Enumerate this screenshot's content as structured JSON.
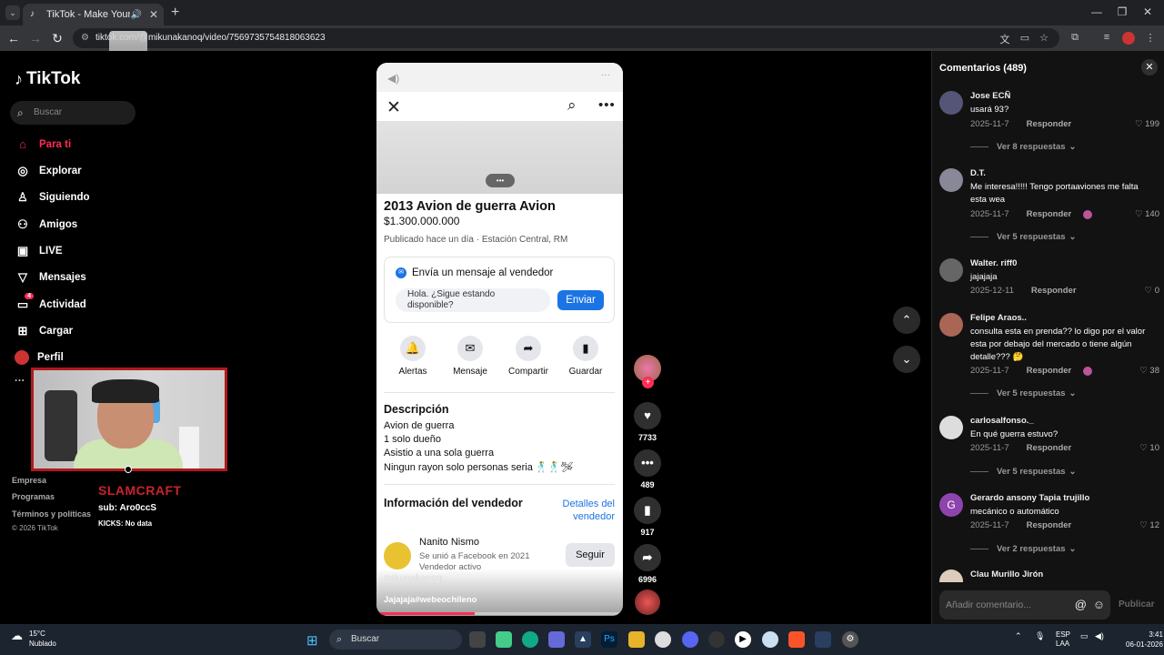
{
  "browser": {
    "tab_title": "TikTok - Make Your Day",
    "url": "tiktok.com/@mikunakanoq/video/7569735754818063623"
  },
  "sidebar": {
    "logo": "TikTok",
    "search_placeholder": "Buscar",
    "items": [
      {
        "label": "Para ti",
        "icon": "home-icon"
      },
      {
        "label": "Explorar",
        "icon": "compass-icon"
      },
      {
        "label": "Siguiendo",
        "icon": "following-icon"
      },
      {
        "label": "Amigos",
        "icon": "friends-icon"
      },
      {
        "label": "LIVE",
        "icon": "live-icon"
      },
      {
        "label": "Mensajes",
        "icon": "messages-icon"
      },
      {
        "label": "Actividad",
        "icon": "activity-icon",
        "badge": "4"
      },
      {
        "label": "Cargar",
        "icon": "upload-icon"
      },
      {
        "label": "Perfil",
        "icon": "profile-icon"
      }
    ],
    "more": "···",
    "footer_company": "Empresa",
    "footer_programs": "Programas",
    "footer_terms": "Términos y políticas",
    "copyright": "© 2026 TikTok"
  },
  "overlay": {
    "brand": "SLAMCRAFT",
    "subs": "sub: Aro0ccS",
    "kicks": "KICKS: No data"
  },
  "video": {
    "listing": {
      "title": "2013 Avion de guerra  Avion",
      "price": "$1.300.000.000",
      "published": "Publicado hace un día · Estación Central, RM",
      "message_header": "Envía un mensaje al vendedor",
      "message_text": "Hola. ¿Sigue estando disponible?",
      "send_label": "Enviar",
      "actions": [
        "Alertas",
        "Mensaje",
        "Compartir",
        "Guardar"
      ],
      "description_title": "Descripción",
      "description_lines": [
        "Avion de guerra",
        "1 solo dueño",
        "Asistio a una sola guerra",
        "Ningun rayon solo personas seria 🕺🕺🛩"
      ],
      "seller_section_title": "Información del vendedor",
      "seller_details_link": "Detalles del vendedor",
      "seller_name": "Nanito Nismo",
      "seller_joined": "Se unió a Facebook en 2021",
      "seller_status": "Vendedor activo",
      "follow_label": "Seguir"
    },
    "username": "mikunakanoq",
    "caption": "Jajajaja#webeochileno",
    "progress": 0.4
  },
  "actions_rail": {
    "likes": "7733",
    "comments": "489",
    "saves": "917",
    "shares": "6996"
  },
  "comments": {
    "title": "Comentarios (489)",
    "input_placeholder": "Añadir comentario...",
    "publish_label": "Publicar",
    "items": [
      {
        "name": "Jose ECÑ",
        "text": "usará 93?",
        "date": "2025-11-7",
        "reply": "Responder",
        "likes": "199",
        "replies": "Ver 8 respuestas"
      },
      {
        "name": "D.T.",
        "text": "Me interesa!!!!! Tengo portaaviones me falta esta wea",
        "date": "2025-11-7",
        "reply": "Responder",
        "likes": "140",
        "replies": "Ver 5 respuestas"
      },
      {
        "name": "Walter. riff0",
        "text": "jajajaja",
        "date": "2025-12-11",
        "reply": "Responder",
        "likes": "0"
      },
      {
        "name": "Felipe Araos..",
        "text": "consulta esta en prenda?? lo digo por el valor esta por debajo del mercado o tiene algún detalle??? 🤔",
        "date": "2025-11-7",
        "reply": "Responder",
        "likes": "38",
        "replies": "Ver 5 respuestas"
      },
      {
        "name": "carlosalfonso._",
        "text": "En qué guerra estuvo?",
        "date": "2025-11-7",
        "reply": "Responder",
        "likes": "10",
        "replies": "Ver 5 respuestas"
      },
      {
        "name": "Gerardo ansony Tapia trujillo",
        "text": "mecánico o automático",
        "date": "2025-11-7",
        "reply": "Responder",
        "likes": "12",
        "replies": "Ver 2 respuestas",
        "avatar_letter": "G"
      },
      {
        "name": "Clau Murillo Jirón"
      }
    ]
  },
  "taskbar": {
    "temp": "15°C",
    "weather": "Nublado",
    "search": "Buscar",
    "lang1": "ESP",
    "lang2": "LAA",
    "time": "3:41",
    "date": "06-01-2026"
  }
}
